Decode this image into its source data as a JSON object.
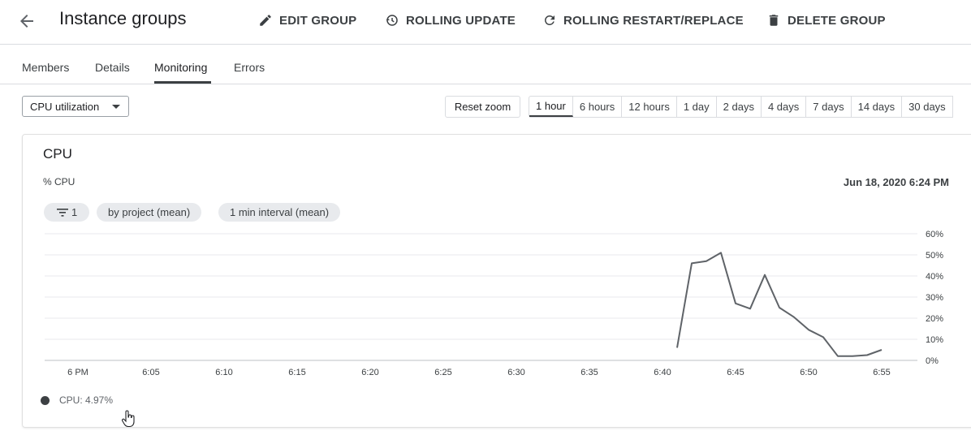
{
  "header": {
    "title": "Instance groups",
    "actions": [
      {
        "label": "EDIT GROUP",
        "icon": "pencil-icon"
      },
      {
        "label": "ROLLING UPDATE",
        "icon": "history-icon"
      },
      {
        "label": "ROLLING RESTART/REPLACE",
        "icon": "refresh-icon"
      },
      {
        "label": "DELETE GROUP",
        "icon": "trash-icon"
      }
    ]
  },
  "tabs": [
    {
      "label": "Members"
    },
    {
      "label": "Details"
    },
    {
      "label": "Monitoring",
      "active": true
    },
    {
      "label": "Errors"
    }
  ],
  "toolbar": {
    "metric": "CPU utilization",
    "reset_zoom": "Reset zoom",
    "ranges": [
      "1 hour",
      "6 hours",
      "12 hours",
      "1 day",
      "2 days",
      "4 days",
      "7 days",
      "14 days",
      "30 days"
    ],
    "active_range": "1 hour"
  },
  "card": {
    "title": "CPU",
    "unit": "% CPU",
    "date": "Jun 18, 2020 6:24 PM",
    "chips": {
      "filter": "1",
      "groupby": "by project (mean)",
      "interval": "1 min interval (mean)"
    },
    "legend": "CPU: 4.97%"
  },
  "colors": {
    "line": "#5f6368",
    "grid": "#e8eaed",
    "text": "#3c4043"
  },
  "chart_data": {
    "type": "line",
    "series": [
      {
        "name": "CPU",
        "x": [
          "6:41",
          "6:42",
          "6:43",
          "6:44",
          "6:45",
          "6:46",
          "6:47",
          "6:48",
          "6:49",
          "6:50",
          "6:51",
          "6:52",
          "6:53",
          "6:54",
          "6:55"
        ],
        "values": [
          6,
          46,
          47,
          51,
          27,
          24.5,
          40.5,
          25,
          20.5,
          14.5,
          11,
          2,
          2,
          2.5,
          5
        ]
      }
    ],
    "x_ticks": [
      "6 PM",
      "6:05",
      "6:10",
      "6:15",
      "6:20",
      "6:25",
      "6:30",
      "6:35",
      "6:40",
      "6:45",
      "6:50",
      "6:55"
    ],
    "y_ticks": [
      "0%",
      "10%",
      "20%",
      "30%",
      "40%",
      "50%",
      "60%"
    ],
    "ylim": [
      0,
      60
    ],
    "grid": true
  }
}
